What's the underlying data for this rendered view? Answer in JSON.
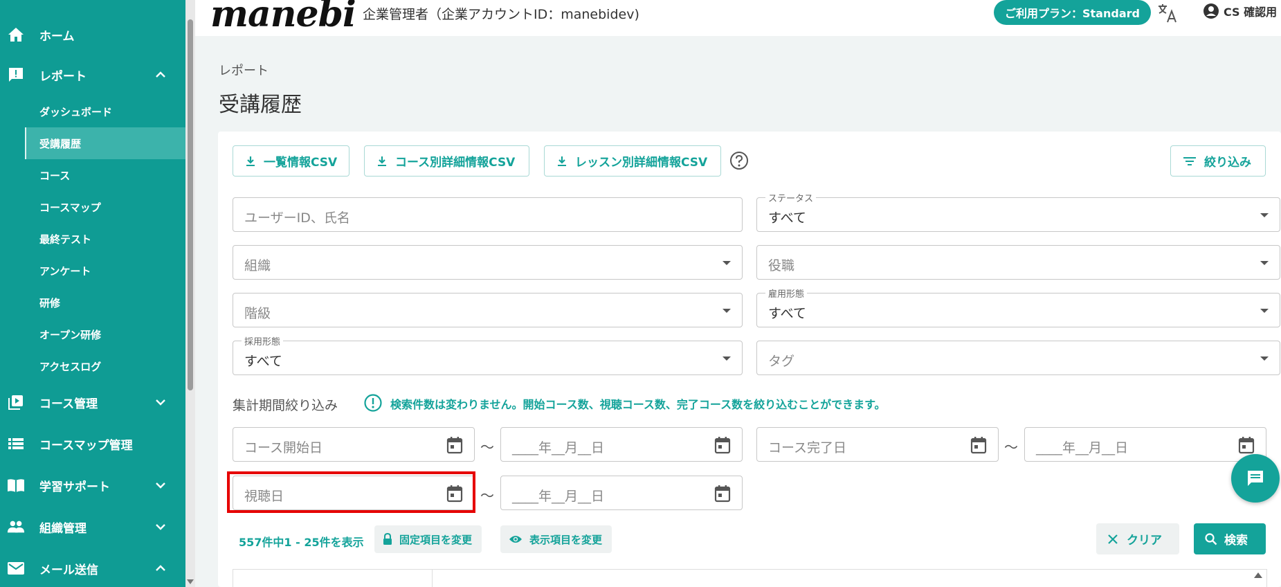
{
  "sidebar": {
    "items": [
      {
        "label": "ホーム",
        "icon": "home-icon"
      },
      {
        "label": "レポート",
        "icon": "report-icon",
        "expanded": true
      },
      {
        "label": "コース管理",
        "icon": "video-library-icon"
      },
      {
        "label": "コースマップ管理",
        "icon": "list-icon"
      },
      {
        "label": "学習サポート",
        "icon": "book-icon"
      },
      {
        "label": "組織管理",
        "icon": "people-icon"
      },
      {
        "label": "メール送信",
        "icon": "mail-icon",
        "expanded": true
      }
    ],
    "report_sub": [
      "ダッシュボード",
      "受講履歴",
      "コース",
      "コースマップ",
      "最終テスト",
      "アンケート",
      "研修",
      "オープン研修",
      "アクセスログ"
    ],
    "active_sub": "受講履歴"
  },
  "header": {
    "logo": "manebi",
    "company": "企業管理者（企業アカウントID：manebidev)",
    "plan": "ご利用プラン：Standard",
    "user": "CS 確認用"
  },
  "main": {
    "breadcrumb": "レポート",
    "title": "受講履歴",
    "toolbar": {
      "csv_list": "一覧情報CSV",
      "csv_course": "コース別詳細情報CSV",
      "csv_lesson": "レッスン別詳細情報CSV",
      "filter": "絞り込み"
    },
    "filters": {
      "user_placeholder": "ユーザーID、氏名",
      "status_label": "ステータス",
      "status_value": "すべて",
      "org_placeholder": "組織",
      "position_placeholder": "役職",
      "grade_placeholder": "階級",
      "employment_label": "雇用形態",
      "employment_value": "すべて",
      "hiring_label": "採用形態",
      "hiring_value": "すべて",
      "tag_placeholder": "タグ"
    },
    "period": {
      "label": "集計期間絞り込み",
      "info": "検索件数は変わりません。開始コース数、視聴コース数、完了コース数を絞り込むことができます。",
      "course_start": "コース開始日",
      "course_end": "コース完了日",
      "view_date": "視聴日",
      "date_placeholder": "____年__月__日",
      "tilde": "〜"
    },
    "results": {
      "count": "557件中1 - 25件を表示",
      "fixed_items": "固定項目を変更",
      "display_items": "表示項目を変更",
      "clear": "クリア",
      "search": "検索"
    }
  }
}
